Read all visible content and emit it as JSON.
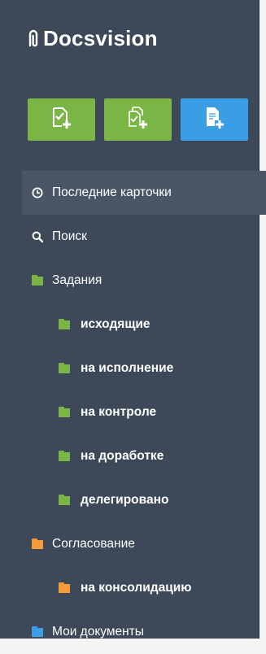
{
  "app": {
    "logo_text": "Docsvision"
  },
  "toolbar": {
    "buttons": [
      {
        "name": "create-card-button",
        "icon": "document-add-icon",
        "color": "#7bb545"
      },
      {
        "name": "create-from-template-button",
        "icon": "document-copy-check-icon",
        "color": "#7bb545"
      },
      {
        "name": "create-document-button",
        "icon": "document-plus-icon",
        "color": "#3a9ee4"
      }
    ]
  },
  "nav": {
    "recent": {
      "label": "Последние карточки",
      "icon": "clock-icon",
      "active": true
    },
    "search": {
      "label": "Поиск",
      "icon": "search-icon"
    },
    "tasks": {
      "label": "Задания",
      "icon": "folder-icon",
      "color": "#7bb545",
      "children": [
        {
          "label": "исходящие",
          "icon": "folder-icon"
        },
        {
          "label": "на исполнение",
          "icon": "folder-icon"
        },
        {
          "label": "на контроле",
          "icon": "folder-icon"
        },
        {
          "label": "на доработке",
          "icon": "folder-icon"
        },
        {
          "label": "делегировано",
          "icon": "folder-icon"
        }
      ]
    },
    "approval": {
      "label": "Согласование",
      "icon": "folder-icon",
      "color": "#f79a3a",
      "children": [
        {
          "label": "на консолидацию",
          "icon": "folder-icon"
        }
      ]
    },
    "my_docs": {
      "label": "Мои документы",
      "icon": "folder-icon",
      "color": "#3a9ee4"
    }
  },
  "colors": {
    "sidebar_bg": "#3d4858",
    "active_bg": "#4a5566",
    "green": "#7bb545",
    "orange": "#f79a3a",
    "blue": "#3a9ee4"
  }
}
